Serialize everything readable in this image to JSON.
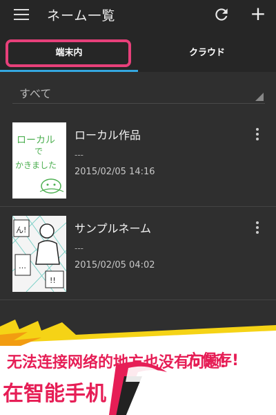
{
  "appbar": {
    "title": "ネーム一覧"
  },
  "tabs": [
    {
      "label": "端末内",
      "selected": true
    },
    {
      "label": "クラウド",
      "selected": false
    }
  ],
  "filter": {
    "selected": "すべて"
  },
  "items": [
    {
      "title": "ローカル作品",
      "subtitle": "---",
      "date": "2015/02/05 14:16",
      "thumb_text": [
        "ローカル",
        "で",
        "かきました"
      ]
    },
    {
      "title": "サンプルネーム",
      "subtitle": "---",
      "date": "2015/02/05 04:02",
      "thumb_text": [
        "ん!",
        "…",
        "!!"
      ]
    }
  ],
  "banner": {
    "line1": "无法连接网络的地方也没有问题!",
    "line2": "在智能手机",
    "line3": "方保存!"
  },
  "colors": {
    "accent": "#35a7e0",
    "highlight": "#e7407a",
    "banner_text": "#e61e56",
    "background": "#2f2f2f",
    "appbar": "#262626"
  }
}
